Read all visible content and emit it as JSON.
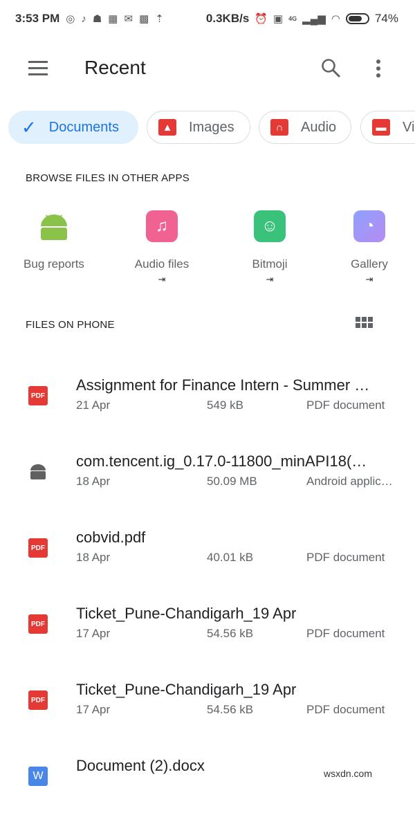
{
  "status_bar": {
    "time": "3:53 PM",
    "speed": "0.3KB/s",
    "network": "4G",
    "battery": "74%"
  },
  "toolbar": {
    "title": "Recent"
  },
  "chips": [
    {
      "label": "Documents",
      "selected": true
    },
    {
      "label": "Images"
    },
    {
      "label": "Audio"
    },
    {
      "label": "Vi"
    }
  ],
  "browse": {
    "heading": "BROWSE FILES IN OTHER APPS",
    "apps": [
      {
        "label": "Bug reports",
        "color": "#8bc34a"
      },
      {
        "label": "Audio files",
        "color": "#f06292"
      },
      {
        "label": "Bitmoji",
        "color": "#3ac27a"
      },
      {
        "label": "Gallery",
        "color": "#7c8cf0"
      }
    ]
  },
  "files": {
    "heading": "FILES ON PHONE",
    "items": [
      {
        "name": "Assignment for Finance Intern - Summer …",
        "date": "21 Apr",
        "size": "549 kB",
        "type": "PDF document",
        "icon": "pdf"
      },
      {
        "name": "com.tencent.ig_0.17.0-11800_minAPI18(…",
        "date": "18 Apr",
        "size": "50.09 MB",
        "type": "Android applic…",
        "icon": "android"
      },
      {
        "name": "cobvid.pdf",
        "date": "18 Apr",
        "size": "40.01 kB",
        "type": "PDF document",
        "icon": "pdf"
      },
      {
        "name": "Ticket_Pune-Chandigarh_19 Apr",
        "date": "17 Apr",
        "size": "54.56 kB",
        "type": "PDF document",
        "icon": "pdf"
      },
      {
        "name": "Ticket_Pune-Chandigarh_19 Apr",
        "date": "17 Apr",
        "size": "54.56 kB",
        "type": "PDF document",
        "icon": "pdf"
      },
      {
        "name": "Document (2).docx",
        "icon": "word"
      }
    ]
  },
  "icon_labels": {
    "pdf": "PDF",
    "word": "W"
  },
  "watermark": "wsxdn.com"
}
